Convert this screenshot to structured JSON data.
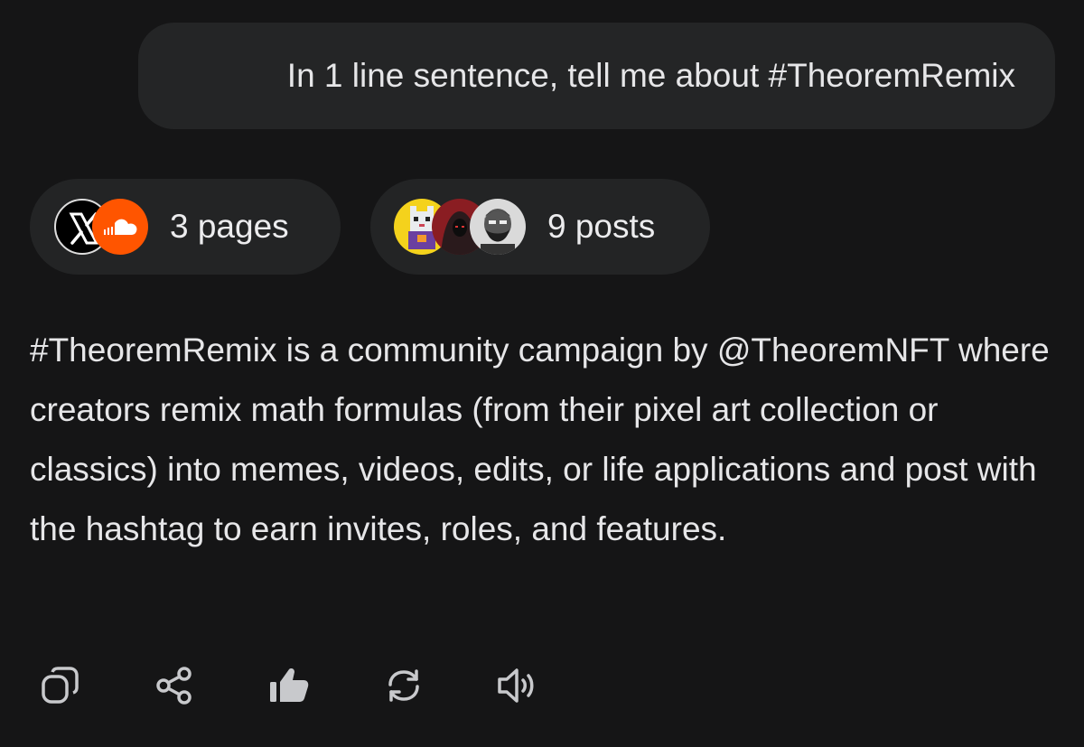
{
  "conversation": {
    "user_prompt": "In 1 line sentence, tell me about #TheoremRemix",
    "sources": {
      "pages_label": "3 pages",
      "pages_icons": [
        "x-logo-icon",
        "soundcloud-icon"
      ],
      "posts_label": "9 posts",
      "posts_avatars": [
        "avatar-pixel-cat",
        "avatar-hooded-figure",
        "avatar-bearded-man"
      ]
    },
    "answer": "#TheoremRemix is a community campaign by @TheoremNFT where creators remix math formulas (from their pixel art collection or classics) into memes, videos, edits, or life applications and post with the hashtag to earn invites, roles, and features."
  },
  "actions": [
    "copy-icon",
    "share-icon",
    "thumbs-up-icon",
    "regenerate-icon",
    "read-aloud-icon"
  ],
  "colors": {
    "background": "#151516",
    "bubble": "#242526",
    "chip": "#232425",
    "text": "#e6e6e8",
    "icon": "#c8c9cc",
    "soundcloud": "#ff5500"
  }
}
